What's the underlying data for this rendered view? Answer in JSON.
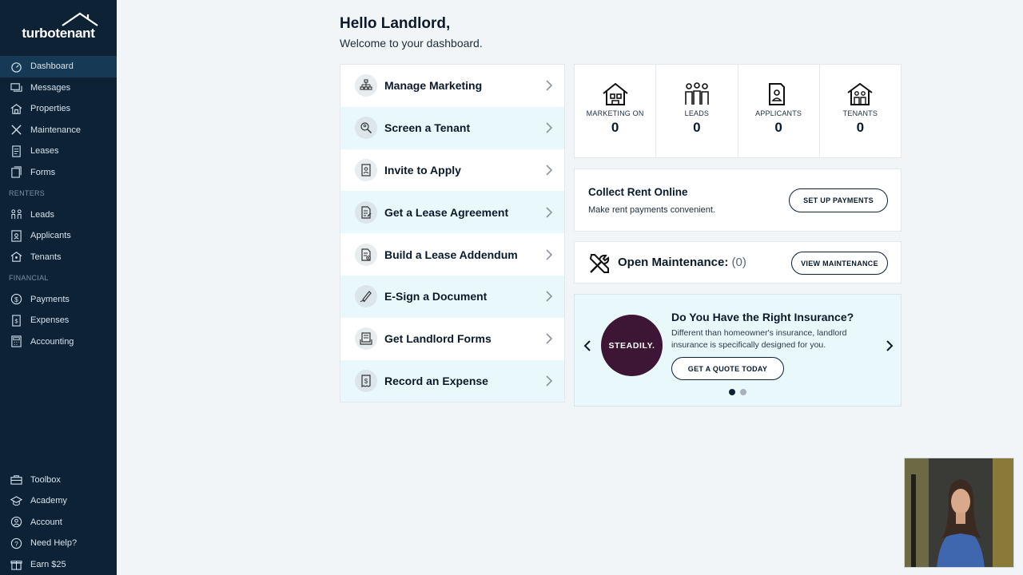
{
  "brand": {
    "logo_text": "turbotenant"
  },
  "sidebar": {
    "items": [
      {
        "label": "Dashboard",
        "icon": "dashboard-icon",
        "active": true
      },
      {
        "label": "Messages",
        "icon": "messages-icon"
      },
      {
        "label": "Properties",
        "icon": "properties-icon"
      },
      {
        "label": "Maintenance",
        "icon": "maintenance-icon"
      },
      {
        "label": "Leases",
        "icon": "leases-icon"
      },
      {
        "label": "Forms",
        "icon": "forms-icon"
      }
    ],
    "renters_section": "RENTERS",
    "renters": [
      {
        "label": "Leads",
        "icon": "leads-icon"
      },
      {
        "label": "Applicants",
        "icon": "applicants-icon"
      },
      {
        "label": "Tenants",
        "icon": "tenants-icon"
      }
    ],
    "financial_section": "FINANCIAL",
    "financial": [
      {
        "label": "Payments",
        "icon": "payments-icon"
      },
      {
        "label": "Expenses",
        "icon": "expenses-icon"
      },
      {
        "label": "Accounting",
        "icon": "accounting-icon"
      }
    ],
    "bottom": [
      {
        "label": "Toolbox",
        "icon": "toolbox-icon"
      },
      {
        "label": "Academy",
        "icon": "academy-icon"
      },
      {
        "label": "Account",
        "icon": "account-icon"
      },
      {
        "label": "Need Help?",
        "icon": "help-icon"
      },
      {
        "label": "Earn $25",
        "icon": "gift-icon"
      }
    ]
  },
  "header": {
    "title": "Hello Landlord,",
    "subtitle": "Welcome to your dashboard."
  },
  "actions": [
    {
      "label": "Manage Marketing",
      "icon": "marketing-icon"
    },
    {
      "label": "Screen a Tenant",
      "icon": "screen-icon"
    },
    {
      "label": "Invite to Apply",
      "icon": "invite-icon"
    },
    {
      "label": "Get a Lease Agreement",
      "icon": "lease-agreement-icon"
    },
    {
      "label": "Build a Lease Addendum",
      "icon": "lease-addendum-icon"
    },
    {
      "label": "E-Sign a Document",
      "icon": "esign-icon"
    },
    {
      "label": "Get Landlord Forms",
      "icon": "landlord-forms-icon"
    },
    {
      "label": "Record an Expense",
      "icon": "expense-icon"
    }
  ],
  "stats": [
    {
      "label": "MARKETING ON",
      "value": "0",
      "icon": "house-icon"
    },
    {
      "label": "LEADS",
      "value": "0",
      "icon": "people-icon"
    },
    {
      "label": "APPLICANTS",
      "value": "0",
      "icon": "applicant-folder-icon"
    },
    {
      "label": "TENANTS",
      "value": "0",
      "icon": "tenants-house-icon"
    }
  ],
  "rent": {
    "title": "Collect Rent Online",
    "subtitle": "Make rent payments convenient.",
    "button": "SET UP PAYMENTS"
  },
  "maintenance": {
    "title": "Open Maintenance:",
    "count": "(0)",
    "button": "VIEW MAINTENANCE"
  },
  "insurance": {
    "logo_text": "STEADILY.",
    "title": "Do You Have the Right Insurance?",
    "description": "Different than homeowner's insurance, landlord insurance is specifically designed for you.",
    "button": "GET A QUOTE TODAY",
    "active_slide": 1,
    "slides": 2
  },
  "colors": {
    "sidebar_bg": "#0d2235",
    "accent_row": "#e8f8fb",
    "page_bg": "#f2f5f7",
    "steadily": "#3d1535"
  }
}
